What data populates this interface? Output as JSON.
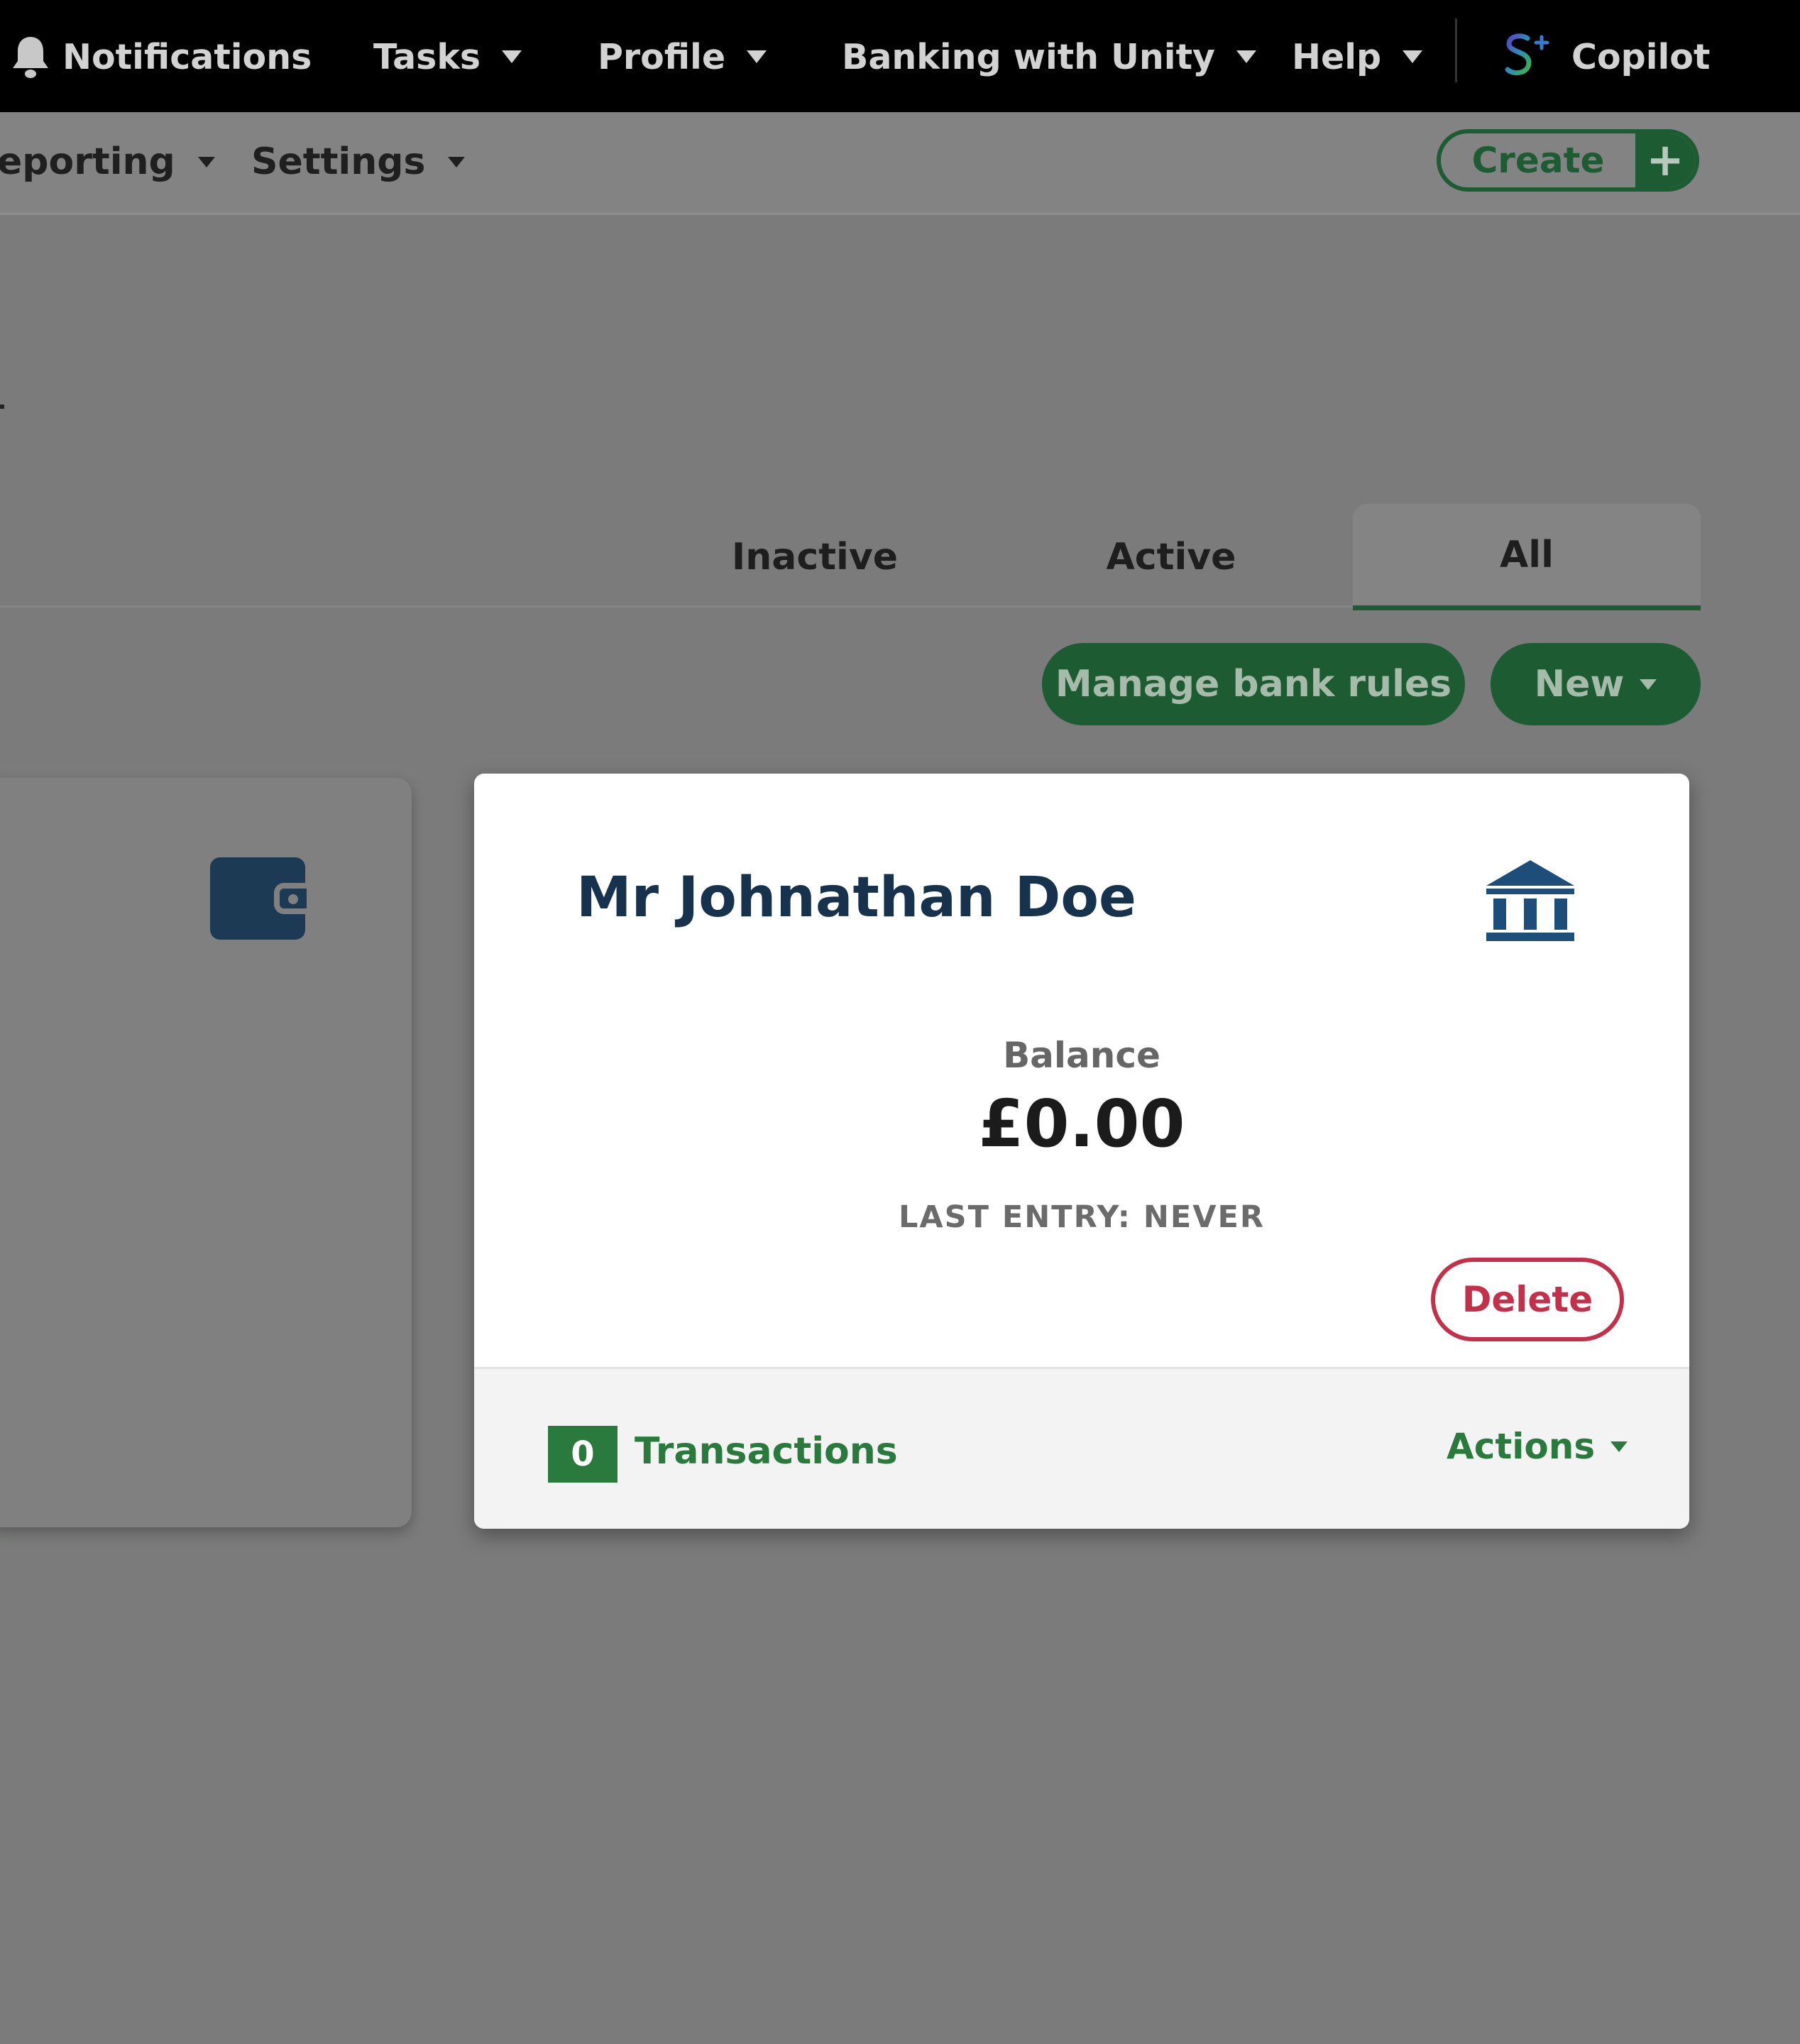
{
  "topnav": {
    "notifications": "Notifications",
    "tasks": "Tasks",
    "profile": "Profile",
    "banking": "Banking with Unity",
    "help": "Help",
    "copilot": "Copilot"
  },
  "subnav": {
    "reporting": "eporting",
    "settings": "Settings",
    "create": "Create"
  },
  "tabs": [
    "Inactive",
    "Active",
    "All"
  ],
  "active_tab": "All",
  "toolbar": {
    "manage_rules": "Manage bank rules",
    "new": "New"
  },
  "account_card": {
    "name": "Mr Johnathan Doe",
    "balance_label": "Balance",
    "balance": "£0.00",
    "last_entry": "LAST ENTRY: NEVER",
    "delete": "Delete",
    "transaction_count": "0",
    "transactions_label": "Transactions",
    "actions": "Actions"
  },
  "colors": {
    "brand_green": "#1d5b33",
    "link_green": "#2b7a3d",
    "danger": "#c4304a",
    "navy": "#17324d"
  }
}
